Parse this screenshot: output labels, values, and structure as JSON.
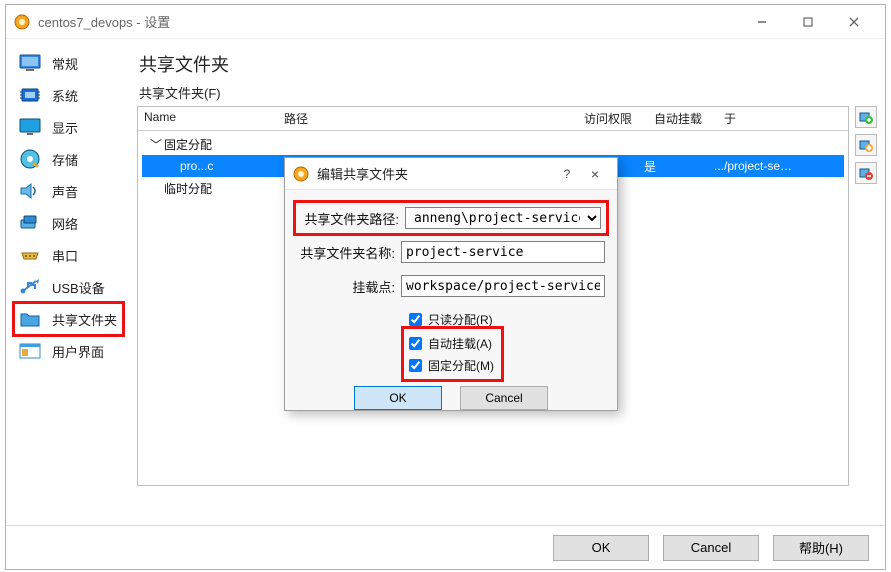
{
  "window": {
    "title": "centos7_devops - 设置"
  },
  "sidebar": {
    "items": [
      {
        "label": "常规",
        "icon": "general"
      },
      {
        "label": "系统",
        "icon": "system"
      },
      {
        "label": "显示",
        "icon": "display"
      },
      {
        "label": "存储",
        "icon": "storage"
      },
      {
        "label": "声音",
        "icon": "audio"
      },
      {
        "label": "网络",
        "icon": "network"
      },
      {
        "label": "串口",
        "icon": "serial"
      },
      {
        "label": "USB设备",
        "icon": "usb"
      },
      {
        "label": "共享文件夹",
        "icon": "folder"
      },
      {
        "label": "用户界面",
        "icon": "ui"
      }
    ],
    "selected_index": 8
  },
  "main": {
    "title": "共享文件夹",
    "section_caption": "共享文件夹(F)",
    "table": {
      "columns": {
        "name": "Name",
        "path": "路径",
        "access": "访问权限",
        "auto": "自动挂载",
        "at": "于"
      },
      "groups": [
        {
          "label": "固定分配",
          "rows": [
            {
              "name": "pro...c",
              "path": "",
              "access": "",
              "auto": "是",
              "at": ".../project-se…"
            }
          ]
        },
        {
          "label": "临时分配",
          "rows": []
        }
      ]
    },
    "right_buttons": {
      "add": "add-icon",
      "edit": "edit-icon",
      "remove": "remove-icon"
    }
  },
  "dialog": {
    "title": "编辑共享文件夹",
    "help_glyph": "?",
    "close_glyph": "×",
    "fields": {
      "path_label": "共享文件夹路径:",
      "path_value": "anneng\\project-service",
      "name_label": "共享文件夹名称:",
      "name_value": "project-service",
      "mount_label": "挂载点:",
      "mount_value": "workspace/project-service"
    },
    "checks": {
      "readonly": "只读分配(R)",
      "automount": "自动挂载(A)",
      "fixed": "固定分配(M)"
    },
    "ok": "OK",
    "cancel": "Cancel"
  },
  "footer": {
    "ok": "OK",
    "cancel": "Cancel",
    "help": "帮助(H)"
  }
}
